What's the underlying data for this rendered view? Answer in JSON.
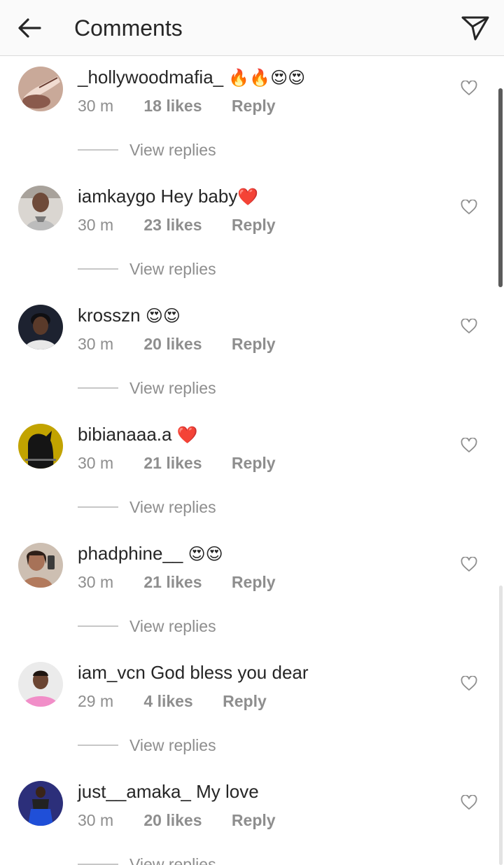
{
  "header": {
    "title": "Comments",
    "back_icon": "arrow-left-icon",
    "share_icon": "paper-plane-icon"
  },
  "comments": [
    {
      "username": "_hollywoodmafia_",
      "text": "",
      "emoji": "🔥🔥😍😍",
      "time": "30 m",
      "likes": "18 likes",
      "reply": "Reply",
      "view_replies": "View replies"
    },
    {
      "username": "iamkaygo",
      "text": "Hey baby",
      "emoji": "❤️",
      "time": "30 m",
      "likes": "23 likes",
      "reply": "Reply",
      "view_replies": "View replies"
    },
    {
      "username": "krosszn",
      "text": "",
      "emoji": "😍😍",
      "time": "30 m",
      "likes": "20 likes",
      "reply": "Reply",
      "view_replies": "View replies"
    },
    {
      "username": "bibianaaa.a",
      "text": "",
      "emoji": "❤️",
      "time": "30 m",
      "likes": "21 likes",
      "reply": "Reply",
      "view_replies": "View replies"
    },
    {
      "username": "phadphine__",
      "text": "",
      "emoji": "😍😍",
      "time": "30 m",
      "likes": "21 likes",
      "reply": "Reply",
      "view_replies": "View replies"
    },
    {
      "username": "iam_vcn",
      "text": "God bless you dear",
      "emoji": "",
      "time": "29 m",
      "likes": "4 likes",
      "reply": "Reply",
      "view_replies": "View replies"
    },
    {
      "username": "just__amaka_",
      "text": "My love",
      "emoji": "",
      "time": "30 m",
      "likes": "20 likes",
      "reply": "Reply",
      "view_replies": "View replies"
    }
  ],
  "colors": {
    "text": "#262626",
    "muted": "#8e8e8e",
    "divider": "#dbdbdb",
    "header_bg": "#fafafa"
  }
}
